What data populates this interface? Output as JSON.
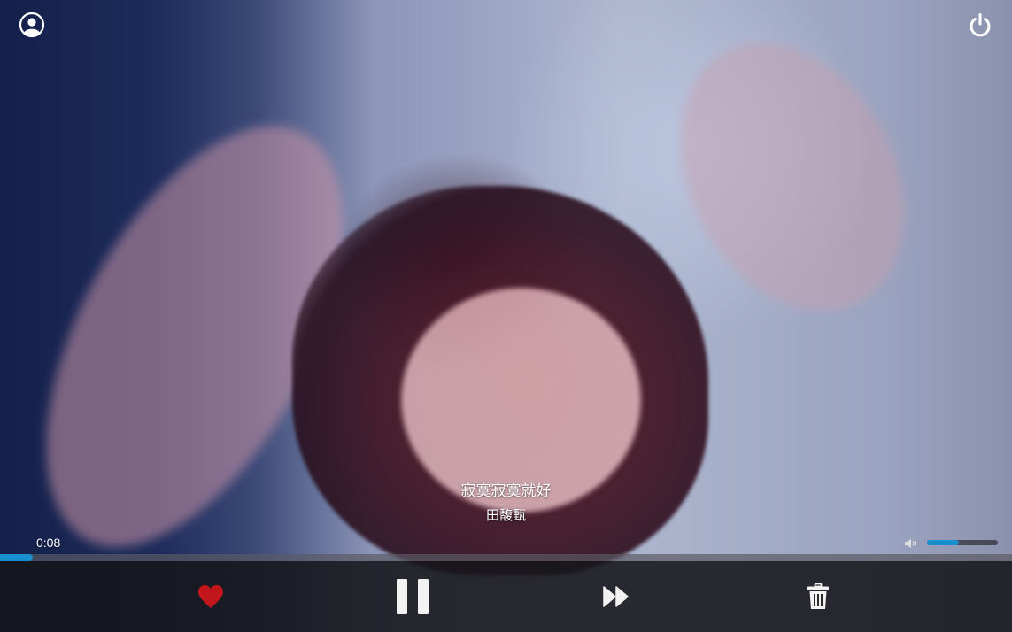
{
  "player": {
    "song_title": "寂寞寂寞就好",
    "artist": "田馥甄",
    "elapsed_time": "0:08",
    "progress_fraction": 0.032,
    "volume_fraction": 0.45,
    "accent_color": "#1a8fd0",
    "like_color": "#c0161c"
  },
  "icons": {
    "profile": "user-profile-icon",
    "power": "power-icon",
    "volume": "speaker-icon",
    "like": "heart-icon",
    "pause": "pause-icon",
    "next": "fast-forward-icon",
    "delete": "trash-icon"
  }
}
